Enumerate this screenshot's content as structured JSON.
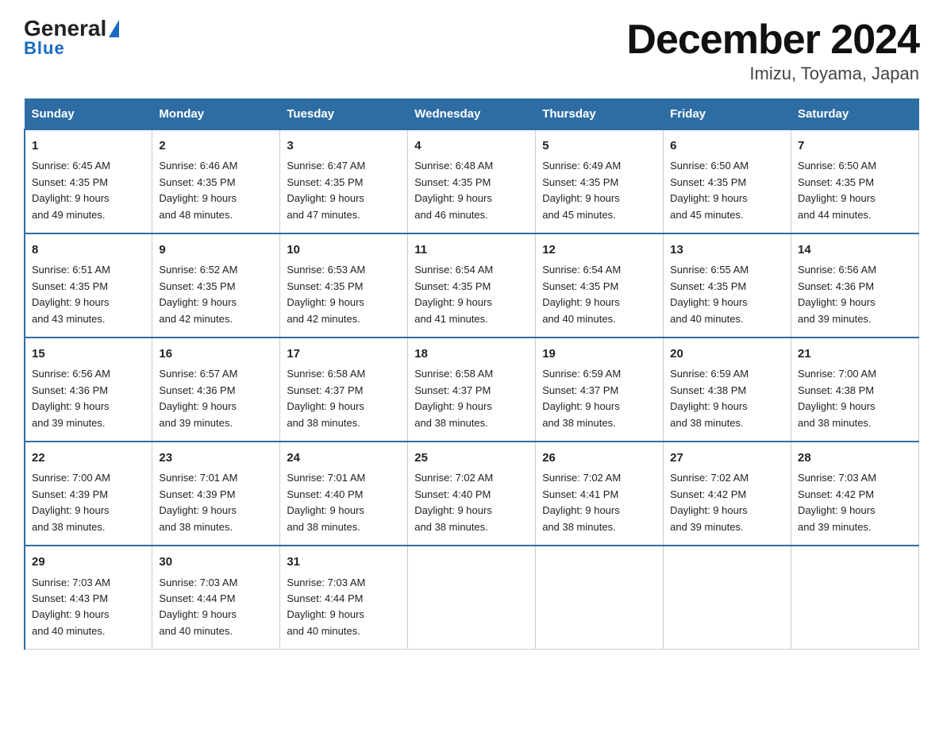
{
  "header": {
    "logo_text_general": "General",
    "logo_text_blue": "Blue",
    "title": "December 2024",
    "subtitle": "Imizu, Toyama, Japan"
  },
  "days_of_week": [
    "Sunday",
    "Monday",
    "Tuesday",
    "Wednesday",
    "Thursday",
    "Friday",
    "Saturday"
  ],
  "weeks": [
    [
      {
        "day": "1",
        "sunrise": "6:45 AM",
        "sunset": "4:35 PM",
        "daylight": "9 hours and 49 minutes."
      },
      {
        "day": "2",
        "sunrise": "6:46 AM",
        "sunset": "4:35 PM",
        "daylight": "9 hours and 48 minutes."
      },
      {
        "day": "3",
        "sunrise": "6:47 AM",
        "sunset": "4:35 PM",
        "daylight": "9 hours and 47 minutes."
      },
      {
        "day": "4",
        "sunrise": "6:48 AM",
        "sunset": "4:35 PM",
        "daylight": "9 hours and 46 minutes."
      },
      {
        "day": "5",
        "sunrise": "6:49 AM",
        "sunset": "4:35 PM",
        "daylight": "9 hours and 45 minutes."
      },
      {
        "day": "6",
        "sunrise": "6:50 AM",
        "sunset": "4:35 PM",
        "daylight": "9 hours and 45 minutes."
      },
      {
        "day": "7",
        "sunrise": "6:50 AM",
        "sunset": "4:35 PM",
        "daylight": "9 hours and 44 minutes."
      }
    ],
    [
      {
        "day": "8",
        "sunrise": "6:51 AM",
        "sunset": "4:35 PM",
        "daylight": "9 hours and 43 minutes."
      },
      {
        "day": "9",
        "sunrise": "6:52 AM",
        "sunset": "4:35 PM",
        "daylight": "9 hours and 42 minutes."
      },
      {
        "day": "10",
        "sunrise": "6:53 AM",
        "sunset": "4:35 PM",
        "daylight": "9 hours and 42 minutes."
      },
      {
        "day": "11",
        "sunrise": "6:54 AM",
        "sunset": "4:35 PM",
        "daylight": "9 hours and 41 minutes."
      },
      {
        "day": "12",
        "sunrise": "6:54 AM",
        "sunset": "4:35 PM",
        "daylight": "9 hours and 40 minutes."
      },
      {
        "day": "13",
        "sunrise": "6:55 AM",
        "sunset": "4:35 PM",
        "daylight": "9 hours and 40 minutes."
      },
      {
        "day": "14",
        "sunrise": "6:56 AM",
        "sunset": "4:36 PM",
        "daylight": "9 hours and 39 minutes."
      }
    ],
    [
      {
        "day": "15",
        "sunrise": "6:56 AM",
        "sunset": "4:36 PM",
        "daylight": "9 hours and 39 minutes."
      },
      {
        "day": "16",
        "sunrise": "6:57 AM",
        "sunset": "4:36 PM",
        "daylight": "9 hours and 39 minutes."
      },
      {
        "day": "17",
        "sunrise": "6:58 AM",
        "sunset": "4:37 PM",
        "daylight": "9 hours and 38 minutes."
      },
      {
        "day": "18",
        "sunrise": "6:58 AM",
        "sunset": "4:37 PM",
        "daylight": "9 hours and 38 minutes."
      },
      {
        "day": "19",
        "sunrise": "6:59 AM",
        "sunset": "4:37 PM",
        "daylight": "9 hours and 38 minutes."
      },
      {
        "day": "20",
        "sunrise": "6:59 AM",
        "sunset": "4:38 PM",
        "daylight": "9 hours and 38 minutes."
      },
      {
        "day": "21",
        "sunrise": "7:00 AM",
        "sunset": "4:38 PM",
        "daylight": "9 hours and 38 minutes."
      }
    ],
    [
      {
        "day": "22",
        "sunrise": "7:00 AM",
        "sunset": "4:39 PM",
        "daylight": "9 hours and 38 minutes."
      },
      {
        "day": "23",
        "sunrise": "7:01 AM",
        "sunset": "4:39 PM",
        "daylight": "9 hours and 38 minutes."
      },
      {
        "day": "24",
        "sunrise": "7:01 AM",
        "sunset": "4:40 PM",
        "daylight": "9 hours and 38 minutes."
      },
      {
        "day": "25",
        "sunrise": "7:02 AM",
        "sunset": "4:40 PM",
        "daylight": "9 hours and 38 minutes."
      },
      {
        "day": "26",
        "sunrise": "7:02 AM",
        "sunset": "4:41 PM",
        "daylight": "9 hours and 38 minutes."
      },
      {
        "day": "27",
        "sunrise": "7:02 AM",
        "sunset": "4:42 PM",
        "daylight": "9 hours and 39 minutes."
      },
      {
        "day": "28",
        "sunrise": "7:03 AM",
        "sunset": "4:42 PM",
        "daylight": "9 hours and 39 minutes."
      }
    ],
    [
      {
        "day": "29",
        "sunrise": "7:03 AM",
        "sunset": "4:43 PM",
        "daylight": "9 hours and 40 minutes."
      },
      {
        "day": "30",
        "sunrise": "7:03 AM",
        "sunset": "4:44 PM",
        "daylight": "9 hours and 40 minutes."
      },
      {
        "day": "31",
        "sunrise": "7:03 AM",
        "sunset": "4:44 PM",
        "daylight": "9 hours and 40 minutes."
      },
      null,
      null,
      null,
      null
    ]
  ],
  "labels": {
    "sunrise": "Sunrise:",
    "sunset": "Sunset:",
    "daylight": "Daylight:"
  }
}
